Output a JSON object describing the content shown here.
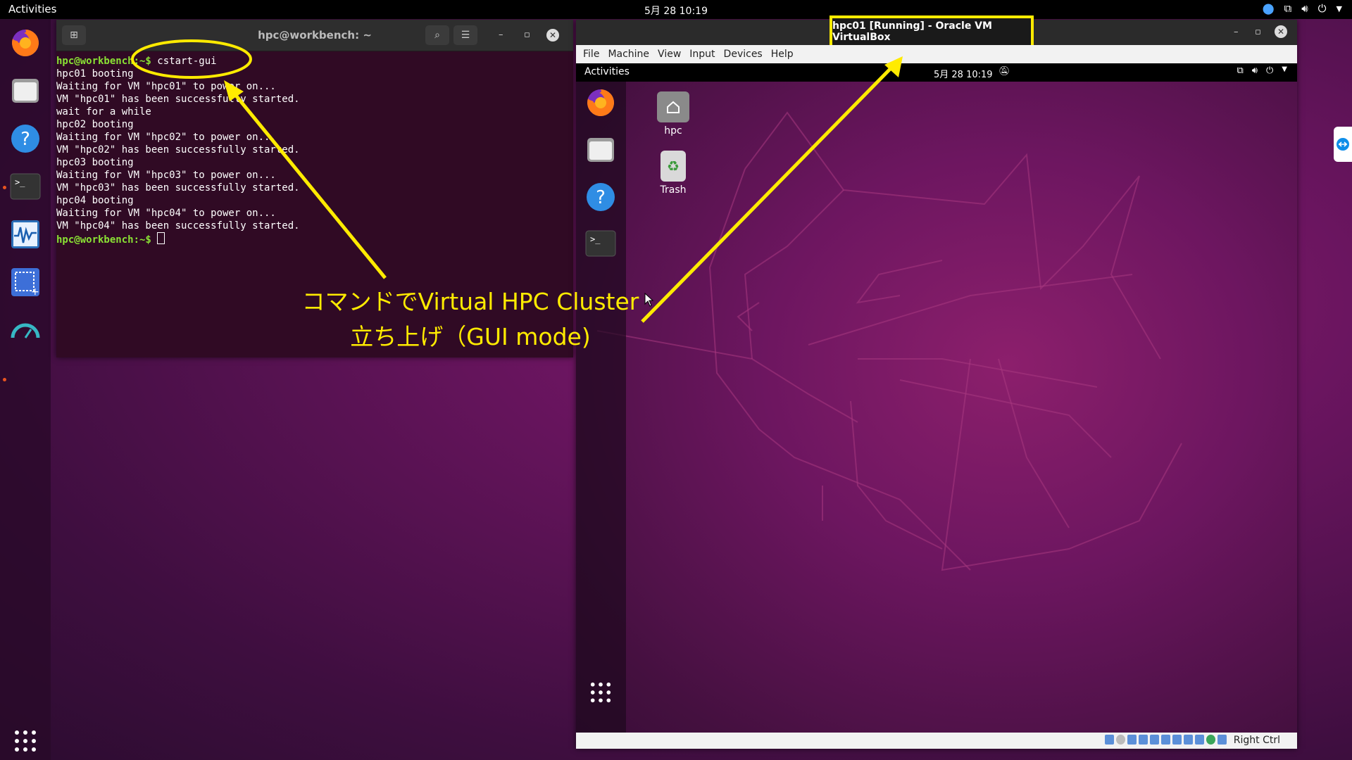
{
  "topbar": {
    "activities": "Activities",
    "clock": "5月 28  10:19"
  },
  "terminal": {
    "title": "hpc@workbench: ~",
    "lines": [
      {
        "prompt": "hpc@workbench:~$ ",
        "text": "cstart-gui"
      },
      {
        "text": "hpc01 booting"
      },
      {
        "text": "Waiting for VM \"hpc01\" to power on..."
      },
      {
        "text": "VM \"hpc01\" has been successfully started."
      },
      {
        "text": "wait for a while"
      },
      {
        "text": "hpc02 booting"
      },
      {
        "text": "Waiting for VM \"hpc02\" to power on..."
      },
      {
        "text": "VM \"hpc02\" has been successfully started."
      },
      {
        "text": "hpc03 booting"
      },
      {
        "text": "Waiting for VM \"hpc03\" to power on..."
      },
      {
        "text": "VM \"hpc03\" has been successfully started."
      },
      {
        "text": "hpc04 booting"
      },
      {
        "text": "Waiting for VM \"hpc04\" to power on..."
      },
      {
        "text": "VM \"hpc04\" has been successfully started."
      }
    ],
    "final_prompt": "hpc@workbench:~$ "
  },
  "vbox": {
    "title": "hpc01 [Running] - Oracle VM VirtualBox",
    "menu": [
      "File",
      "Machine",
      "View",
      "Input",
      "Devices",
      "Help"
    ],
    "guest_activities": "Activities",
    "guest_clock": "5月 28  10:19",
    "desktop_icons": [
      "hpc",
      "Trash"
    ],
    "host_key": "Right Ctrl"
  },
  "annotation": {
    "line1": "コマンドでVirtual HPC Cluster",
    "line2": "立ち上げ（GUI mode)"
  },
  "colors": {
    "highlight": "#ffeb00",
    "prompt": "#8ae234",
    "terminal_bg": "#300a24"
  }
}
